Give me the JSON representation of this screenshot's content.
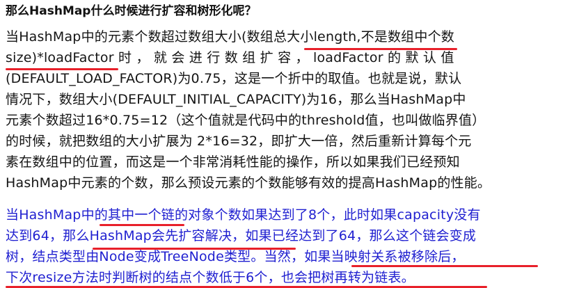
{
  "heading": "那么HashMap什么时候进行扩容和树形化呢？",
  "paragraph1": {
    "line1": "当HashMap中的元素个数超过数组大小(数组总大小length,不是数组中个数",
    "line2_parts": [
      "size)*loadFactor",
      "时",
      "，",
      "就",
      "会",
      "进",
      "行",
      "数",
      "组",
      "扩",
      "容",
      "，",
      "loadFactor",
      "的",
      "默",
      "认",
      "值"
    ],
    "line3": "(DEFAULT_LOAD_FACTOR)为0.75，这是一个折中的取值。也就是说，默认",
    "line4": "情况下，数组大小(DEFAULT_INITIAL_CAPACITY)为16，那么当HashMap中",
    "line5": "元素个数超过16*0.75=12（这个值就是代码中的threshold值，也叫做临界值）",
    "line6": "的时候，就把数组的大小扩展为 2*16=32，即扩大一倍，然后重新计算每个元",
    "line7": "素在数组中的位置，而这是一个非常消耗性能的操作，所以如果我们已经预知",
    "line8": "HashMap中元素的个数，那么预设元素的个数能够有效的提高HashMap的性能。"
  },
  "paragraph2": {
    "line1": "当HashMap中的其中一个链的对象个数如果达到了8个，此时如果capacity没有",
    "line2": "达到64，那么HashMap会先扩容解决，如果已经达到了64，那么这个链会变成",
    "line3": "树，结点类型由Node变成TreeNode类型。当然，如果当映射关系被移除后，",
    "line4": "下次resize方法时判断树的结点个数低于6个，也会把树再转为链表。"
  },
  "colors": {
    "body_text": "#141414",
    "highlight_text": "#1f1fd0",
    "underline": "#e8202a",
    "background": "#ffffff"
  }
}
